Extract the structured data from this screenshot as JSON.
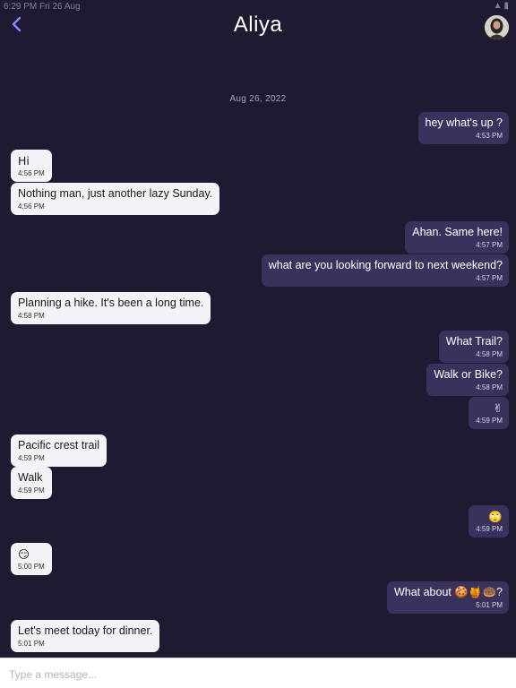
{
  "status_bar": {
    "time": "6:29 PM",
    "date": "Fri 26 Aug"
  },
  "header": {
    "title": "Aliya"
  },
  "date_separator": "Aug 26, 2022",
  "messages": [
    {
      "dir": "out",
      "text": "hey what's up ?",
      "time": "4:53 PM"
    },
    {
      "dir": "in",
      "text": "Hi",
      "time": "4:56 PM"
    },
    {
      "dir": "in",
      "text": "Nothing man, just another lazy Sunday.",
      "time": "4:56 PM"
    },
    {
      "dir": "out",
      "text": "Ahan. Same here!",
      "time": "4:57 PM"
    },
    {
      "dir": "out",
      "text": "what are you looking forward to next weekend?",
      "time": "4:57 PM"
    },
    {
      "dir": "in",
      "text": "Planning a hike. It's been a long time.",
      "time": "4:58 PM"
    },
    {
      "dir": "out",
      "text": "What Trail?",
      "time": "4:58 PM"
    },
    {
      "dir": "out",
      "text": "Walk or Bike?",
      "time": "4:58 PM"
    },
    {
      "dir": "out",
      "text": "✌",
      "time": "4:59 PM"
    },
    {
      "dir": "in",
      "text": "Pacific crest trail",
      "time": "4:59 PM"
    },
    {
      "dir": "in",
      "text": "Walk",
      "time": "4:59 PM"
    },
    {
      "dir": "out",
      "text": "🙄",
      "time": "4:59 PM"
    },
    {
      "dir": "in",
      "text": "😏",
      "time": "5:00 PM"
    },
    {
      "dir": "out",
      "text": "What about 🍪🍯🍩?",
      "time": "5:01 PM"
    },
    {
      "dir": "in",
      "text": "Let's meet today for dinner.",
      "time": "5:01 PM"
    }
  ],
  "composer": {
    "placeholder": "Type a message..."
  }
}
